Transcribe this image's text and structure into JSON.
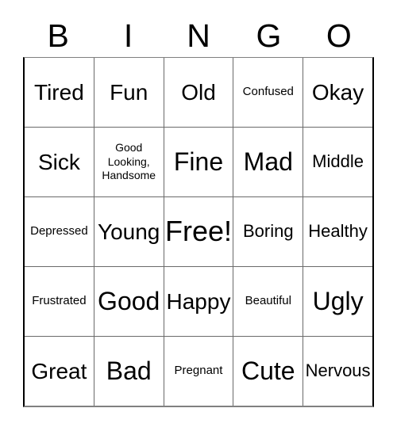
{
  "card": {
    "title": "BINGO",
    "header_letters": [
      "B",
      "I",
      "N",
      "G",
      "O"
    ],
    "columns": 5,
    "rows": 5,
    "colors": {
      "background": "#ffffff",
      "text": "#000000",
      "grid_line": "#6a6a6a",
      "outer_border": "#000000"
    },
    "grid": [
      [
        {
          "label": "Tired",
          "size": "md"
        },
        {
          "label": "Fun",
          "size": "md"
        },
        {
          "label": "Old",
          "size": "md"
        },
        {
          "label": "Confused",
          "size": "xs"
        },
        {
          "label": "Okay",
          "size": "md"
        }
      ],
      [
        {
          "label": "Sick",
          "size": "md"
        },
        {
          "label": "Good\nLooking,\nHandsome",
          "size": "xxs"
        },
        {
          "label": "Fine",
          "size": "lg"
        },
        {
          "label": "Mad",
          "size": "lg"
        },
        {
          "label": "Middle",
          "size": "sm"
        }
      ],
      [
        {
          "label": "Depressed",
          "size": "xs"
        },
        {
          "label": "Young",
          "size": "md"
        },
        {
          "label": "Free!",
          "size": "xl"
        },
        {
          "label": "Boring",
          "size": "sm"
        },
        {
          "label": "Healthy",
          "size": "sm"
        }
      ],
      [
        {
          "label": "Frustrated",
          "size": "xs"
        },
        {
          "label": "Good",
          "size": "lg"
        },
        {
          "label": "Happy",
          "size": "md"
        },
        {
          "label": "Beautiful",
          "size": "xs"
        },
        {
          "label": "Ugly",
          "size": "lg"
        }
      ],
      [
        {
          "label": "Great",
          "size": "md"
        },
        {
          "label": "Bad",
          "size": "lg"
        },
        {
          "label": "Pregnant",
          "size": "xs"
        },
        {
          "label": "Cute",
          "size": "lg"
        },
        {
          "label": "Nervous",
          "size": "sm"
        }
      ]
    ]
  }
}
